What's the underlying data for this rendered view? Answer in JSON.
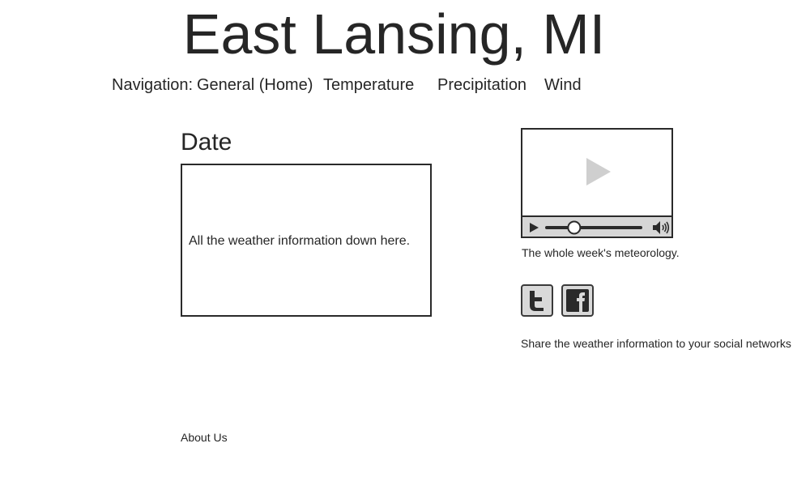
{
  "header": {
    "title": "East Lansing, MI"
  },
  "nav": {
    "label": "Navigation:",
    "items": [
      {
        "label": "General (Home)"
      },
      {
        "label": "Temperature"
      },
      {
        "label": "Precipitation"
      },
      {
        "label": "Wind"
      }
    ]
  },
  "main": {
    "date_heading": "Date",
    "weather_text": "All the weather information down here."
  },
  "sidebar": {
    "video": {
      "caption": "The whole week's meteorology.",
      "progress": 0.27,
      "icons": [
        "play-icon",
        "volume-icon"
      ]
    },
    "social": {
      "buttons": [
        "twitter-icon",
        "facebook-icon"
      ],
      "share_text": "Share the weather information to your social networks"
    }
  },
  "footer": {
    "about_label": "About Us"
  },
  "colors": {
    "text": "#262626",
    "border": "#2a2a2a",
    "control_bar": "#d6d6d6",
    "button_fill": "#d9d9d9",
    "play_overlay": "#cfcfcf"
  }
}
